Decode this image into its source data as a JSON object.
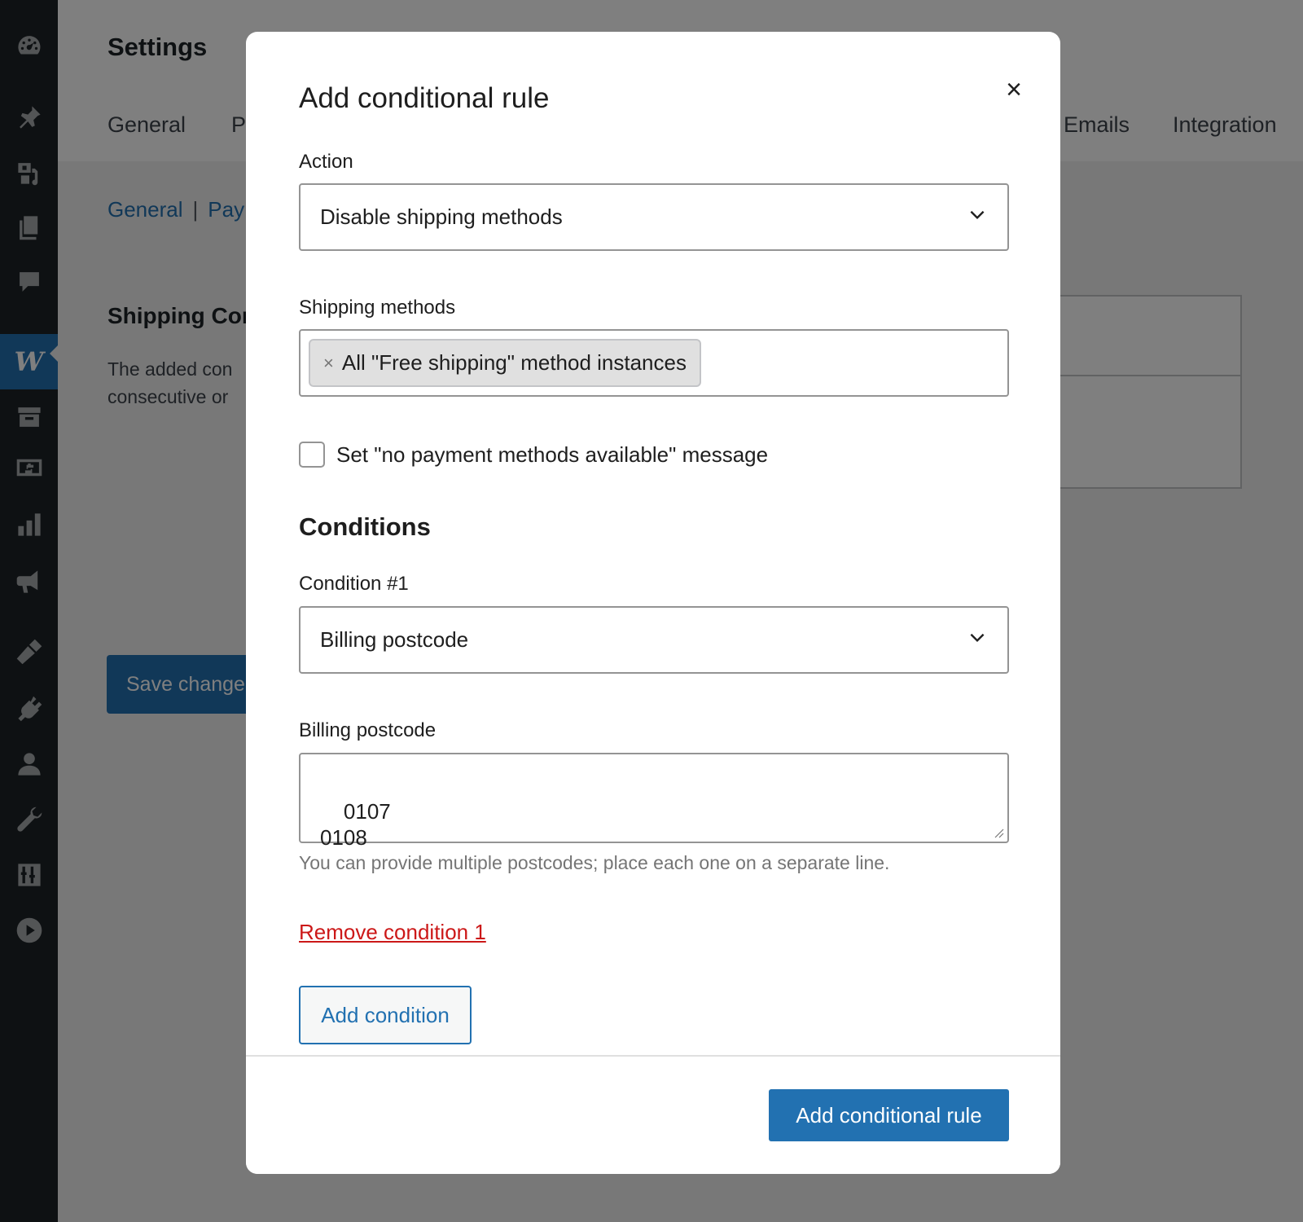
{
  "background": {
    "page_title": "Settings",
    "tabs": [
      {
        "label": "General"
      },
      {
        "label": "P"
      },
      {
        "label": "Emails"
      },
      {
        "label": "Integration"
      }
    ],
    "subnav": {
      "item1": "General",
      "separator": "|",
      "item2": "Pay"
    },
    "section_title": "Shipping Cor",
    "section_desc_line1": "The added con",
    "section_desc_line2": "consecutive or",
    "save_button": "Save change"
  },
  "sidebar": {
    "icons": [
      "dashboard-icon",
      "pin-icon",
      "media-icon",
      "pages-icon",
      "comments-icon",
      "woocommerce-icon",
      "products-icon",
      "payments-icon",
      "analytics-icon",
      "marketing-icon",
      "appearance-icon",
      "plugins-icon",
      "users-icon",
      "tools-icon",
      "settings-icon",
      "media-player-icon"
    ]
  },
  "modal": {
    "title": "Add conditional rule",
    "close_symbol": "×",
    "action_label": "Action",
    "action_value": "Disable shipping methods",
    "shipping_methods_label": "Shipping methods",
    "shipping_token": "All \"Free shipping\" method instances",
    "token_remove_symbol": "×",
    "checkbox_label": "Set \"no payment methods available\" message",
    "conditions_heading": "Conditions",
    "condition1_label": "Condition #1",
    "condition1_value": "Billing postcode",
    "postcode_label": "Billing postcode",
    "postcode_value": "0107\n0108",
    "help_text": "You can provide multiple postcodes; place each one on a separate line.",
    "remove_condition": "Remove condition 1",
    "add_condition": "Add condition",
    "submit": "Add conditional rule"
  }
}
